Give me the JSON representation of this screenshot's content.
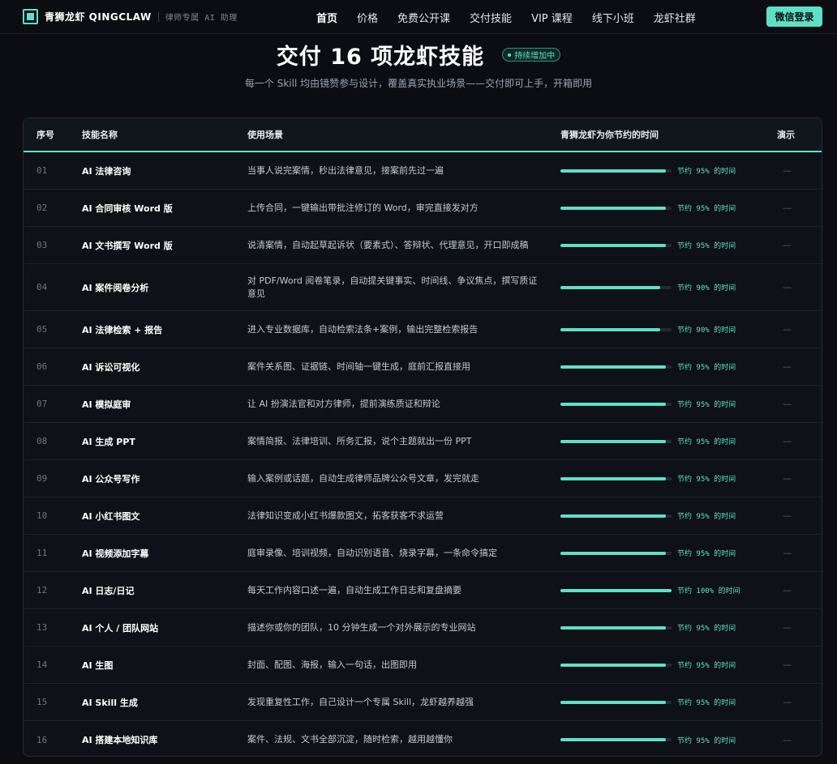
{
  "header": {
    "logo_text": "青狮龙虾 QINGCLAW",
    "logo_sub": "律师专属 AI 助理",
    "nav": [
      {
        "label": "首页",
        "active": true
      },
      {
        "label": "价格",
        "active": false
      },
      {
        "label": "免费公开课",
        "active": false
      },
      {
        "label": "交付技能",
        "active": false
      },
      {
        "label": "VIP 课程",
        "active": false
      },
      {
        "label": "线下小班",
        "active": false
      },
      {
        "label": "龙虾社群",
        "active": false
      }
    ],
    "login_label": "微信登录"
  },
  "hero": {
    "title": "交付 16 项龙虾技能",
    "badge": "持续增加中",
    "subtitle": "每一个 Skill 均由镜赞参与设计，覆盖真实执业场景——交付即可上手，开箱即用"
  },
  "table": {
    "columns": [
      "序号",
      "技能名称",
      "使用场景",
      "青狮龙虾为你节约的时间",
      "演示"
    ],
    "rows": [
      {
        "no": "01",
        "name": "AI 法律咨询",
        "scene": "当事人说完案情，秒出法律意见，接案前先过一遍",
        "saved_percent": 95,
        "saved_label": "节约 95% 的时间",
        "demo": "—"
      },
      {
        "no": "02",
        "name": "AI 合同审核 Word 版",
        "scene": "上传合同，一键输出带批注修订的 Word，审完直接发对方",
        "saved_percent": 95,
        "saved_label": "节约 95% 的时间",
        "demo": "—"
      },
      {
        "no": "03",
        "name": "AI 文书撰写 Word 版",
        "scene": "说清案情，自动起草起诉状（要素式）、答辩状、代理意见，开口即成稿",
        "saved_percent": 95,
        "saved_label": "节约 95% 的时间",
        "demo": "—"
      },
      {
        "no": "04",
        "name": "AI 案件阅卷分析",
        "scene": "对 PDF/Word 阅卷笔录，自动提关键事实、时间线、争议焦点，撰写质证意见",
        "saved_percent": 90,
        "saved_label": "节约 90% 的时间",
        "demo": "—"
      },
      {
        "no": "05",
        "name": "AI 法律检索 + 报告",
        "scene": "进入专业数据库，自动检索法条+案例，输出完整检索报告",
        "saved_percent": 90,
        "saved_label": "节约 90% 的时间",
        "demo": "—"
      },
      {
        "no": "06",
        "name": "AI 诉讼可视化",
        "scene": "案件关系图、证据链、时间轴一键生成，庭前汇报直接用",
        "saved_percent": 95,
        "saved_label": "节约 95% 的时间",
        "demo": "—"
      },
      {
        "no": "07",
        "name": "AI 模拟庭审",
        "scene": "让 AI 扮演法官和对方律师，提前演练质证和辩论",
        "saved_percent": 95,
        "saved_label": "节约 95% 的时间",
        "demo": "—"
      },
      {
        "no": "08",
        "name": "AI 生成 PPT",
        "scene": "案情简报、法律培训、所务汇报，说个主题就出一份 PPT",
        "saved_percent": 95,
        "saved_label": "节约 95% 的时间",
        "demo": "—"
      },
      {
        "no": "09",
        "name": "AI 公众号写作",
        "scene": "输入案例或话题，自动生成律师品牌公众号文章，发完就走",
        "saved_percent": 95,
        "saved_label": "节约 95% 的时间",
        "demo": "—"
      },
      {
        "no": "10",
        "name": "AI 小红书图文",
        "scene": "法律知识变成小红书爆款图文，拓客获客不求运营",
        "saved_percent": 95,
        "saved_label": "节约 95% 的时间",
        "demo": "—"
      },
      {
        "no": "11",
        "name": "AI 视频添加字幕",
        "scene": "庭审录像、培训视频，自动识别语音、烧录字幕，一条命令搞定",
        "saved_percent": 95,
        "saved_label": "节约 95% 的时间",
        "demo": "—"
      },
      {
        "no": "12",
        "name": "AI 日志/日记",
        "scene": "每天工作内容口述一遍，自动生成工作日志和复盘摘要",
        "saved_percent": 100,
        "saved_label": "节约 100% 的时间",
        "demo": "—"
      },
      {
        "no": "13",
        "name": "AI 个人 / 团队网站",
        "scene": "描述你或你的团队，10 分钟生成一个对外展示的专业网站",
        "saved_percent": 95,
        "saved_label": "节约 95% 的时间",
        "demo": "—"
      },
      {
        "no": "14",
        "name": "AI 生图",
        "scene": "封面、配图、海报，输入一句话，出图即用",
        "saved_percent": 95,
        "saved_label": "节约 95% 的时间",
        "demo": "—"
      },
      {
        "no": "15",
        "name": "AI Skill 生成",
        "scene": "发现重复性工作，自己设计一个专属 Skill，龙虾越养越强",
        "saved_percent": 95,
        "saved_label": "节约 95% 的时间",
        "demo": "—"
      },
      {
        "no": "16",
        "name": "AI 搭建本地知识库",
        "scene": "案件、法规、文书全部沉淀，随时检索，越用越懂你",
        "saved_percent": 95,
        "saved_label": "节约 95% 的时间",
        "demo": "—"
      }
    ]
  }
}
